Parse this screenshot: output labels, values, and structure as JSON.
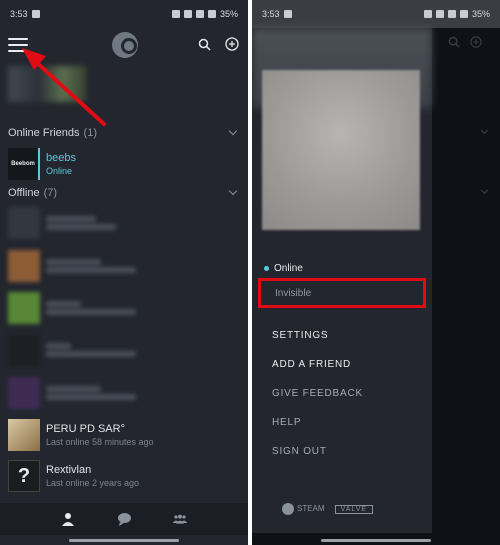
{
  "left_screen": {
    "status_bar": {
      "time": "3:53",
      "battery": "35%"
    },
    "sections": {
      "online_title": "Online Friends",
      "online_count": "(1)",
      "offline_title": "Offline",
      "offline_count": "(7)"
    },
    "online_friend": {
      "avatar_text": "Beebom",
      "name": "beebs",
      "status": "Online"
    },
    "offline_friends": [
      {
        "name": "PERU PD SAR°",
        "status": "Last online 58 minutes ago"
      },
      {
        "name": "Rextivlan",
        "status": "Last online 2 years ago"
      }
    ]
  },
  "right_screen": {
    "status_bar": {
      "time": "3:53",
      "battery": "35%"
    },
    "status_options": {
      "online": "Online",
      "invisible": "Invisible"
    },
    "menu": {
      "settings": "SETTINGS",
      "add_friend": "ADD A FRIEND",
      "feedback": "GIVE FEEDBACK",
      "help": "HELP",
      "sign_out": "SIGN OUT"
    },
    "logos": {
      "steam": "STEAM",
      "valve": "VALVE"
    }
  },
  "colors": {
    "accent": "#57cbde",
    "highlight_red": "#e10b14",
    "annotation_arrow": "#e10b14"
  }
}
